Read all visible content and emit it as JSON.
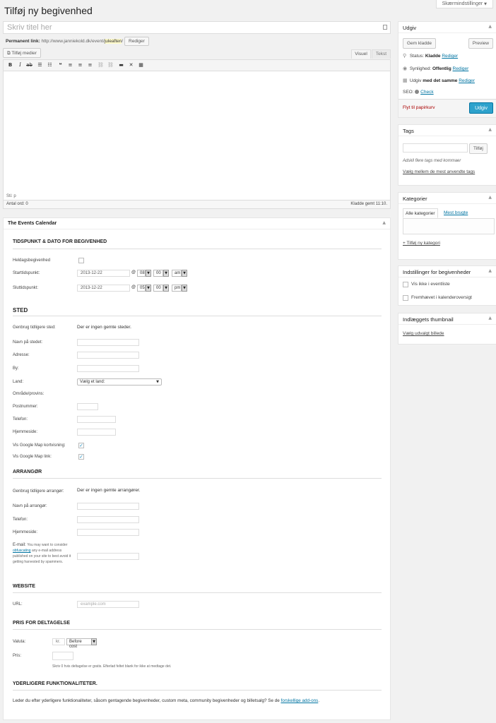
{
  "header": {
    "title": "Tilføj ny begivenhed",
    "screen_options": "Skærmindstillinger"
  },
  "post": {
    "title_placeholder": "Skriv titel her",
    "permalink_label": "Permanent link:",
    "permalink_base": "http://www.janniekold.dk/event/",
    "permalink_slug": "juleaften",
    "permalink_end": "/",
    "permalink_edit": "Rediger"
  },
  "editor": {
    "add_media": "Tilføj medier",
    "tab_visual": "Visuel",
    "tab_text": "Tekst",
    "path": "Sti: p",
    "word_count": "Antal ord: 0",
    "draft_saved": "Kladde gemt 11:10."
  },
  "events": {
    "box_title": "The Events Calendar",
    "datetime_heading": "TIDSPUNKT & DATO FOR BEGIVENHED",
    "allday_label": "Heldagsbegivenhed",
    "start_label": "Starttidspunkt:",
    "start_date": "2013-12-22",
    "start_hour": "08",
    "start_minute": "00",
    "start_ampm": "am",
    "end_label": "Sluttidspunkt:",
    "end_date": "2013-12-22",
    "end_hour": "05",
    "end_minute": "00",
    "end_ampm": "pm",
    "at_symbol": "@",
    "venue_heading": "STED",
    "reuse_venue_label": "Genbrug tidligere sted:",
    "reuse_venue_value": "Der er ingen gemte steder.",
    "venue_name_label": "Navn på stedet:",
    "address_label": "Adresse:",
    "city_label": "By:",
    "country_label": "Land:",
    "country_value": "Vælg et land:",
    "region_label": "Område/provins:",
    "zip_label": "Postnummer:",
    "phone_label": "Telefon:",
    "website_label": "Hjemmeside:",
    "show_map_label": "Vis Google Map kortvisning:",
    "show_map_link_label": "Vis Google Map link:",
    "organizer_heading": "ARRANGØR",
    "reuse_org_label": "Genbrug tidligere arrangør:",
    "reuse_org_value": "Der er ingen gemte arrangører.",
    "org_name_label": "Navn på arrangør:",
    "org_phone_label": "Telefon:",
    "org_website_label": "Hjemmeside:",
    "email_label": "E-mail:",
    "email_note_1": "You may want to consider",
    "email_note_link": "obfuscating",
    "email_note_2": "any e-mail address published on your site to best avoid it getting harvested by spammers.",
    "website_heading": "WEBSITE",
    "url_label": "URL:",
    "url_placeholder": "example.com",
    "price_heading": "PRIS FOR DELTAGELSE",
    "valuta_label": "Valuta:",
    "valuta_value": "kr.",
    "valuta_pos": "Before cost",
    "price_label": "Pris:",
    "price_note": "Skriv 0 hvis deltagelse er gratis. Efterlad feltet blank for ikke at medtage det.",
    "more_heading": "YDERLIGERE FUNKTIONALITETER.",
    "more_text": "Leder du efter yderligere funktionaliteter, såsom gentagende begivenheder, custom meta, community begivenheder og billetsalg? Se de",
    "more_link": "forskellige add-ons",
    "more_end": "."
  },
  "publish": {
    "title": "Udgiv",
    "save_draft": "Gem kladde",
    "preview": "Preview",
    "status_label": "Status:",
    "status_value": "Kladde",
    "edit": "Rediger",
    "visibility_label": "Synlighed:",
    "visibility_value": "Offentlig",
    "publish_label": "Udgiv",
    "publish_value": "med det samme",
    "seo_label": "SEO:",
    "seo_check": "Check",
    "trash": "Flyt til papirkurv",
    "publish_button": "Udgiv"
  },
  "tags": {
    "title": "Tags",
    "add_button": "Tilføj",
    "hint": "Adskil flere tags med kommaer",
    "most_used": "Vælg mellem de mest anvendte tags"
  },
  "categories": {
    "title": "Kategorier",
    "tab_all": "Alle kategorier",
    "tab_most": "Mest brugte",
    "add_new": "+ Tilføj ny kategori"
  },
  "event_settings": {
    "title": "Indstillinger for begivenheder",
    "hide_from_list": "Vis ikke i eventliste",
    "featured": "Fremhævet i kalenderoversigt"
  },
  "thumbnail": {
    "title": "Indlæggets thumbnail",
    "set_link": "Vælg udvalgt billede"
  },
  "colors": {
    "link": "#0074a2",
    "primary_button": "#2ea2cc",
    "trash": "#aa0000"
  },
  "icons": [
    "close-icon",
    "chevron-up-icon",
    "media-icon",
    "bold-icon",
    "italic-icon",
    "strike-icon",
    "bullet-list-icon",
    "number-list-icon",
    "blockquote-icon",
    "align-left-icon",
    "align-center-icon",
    "align-right-icon",
    "link-icon",
    "unlink-icon",
    "more-icon",
    "fullscreen-icon",
    "kitchen-sink-icon",
    "calendar-icon",
    "eye-icon",
    "pin-icon"
  ]
}
